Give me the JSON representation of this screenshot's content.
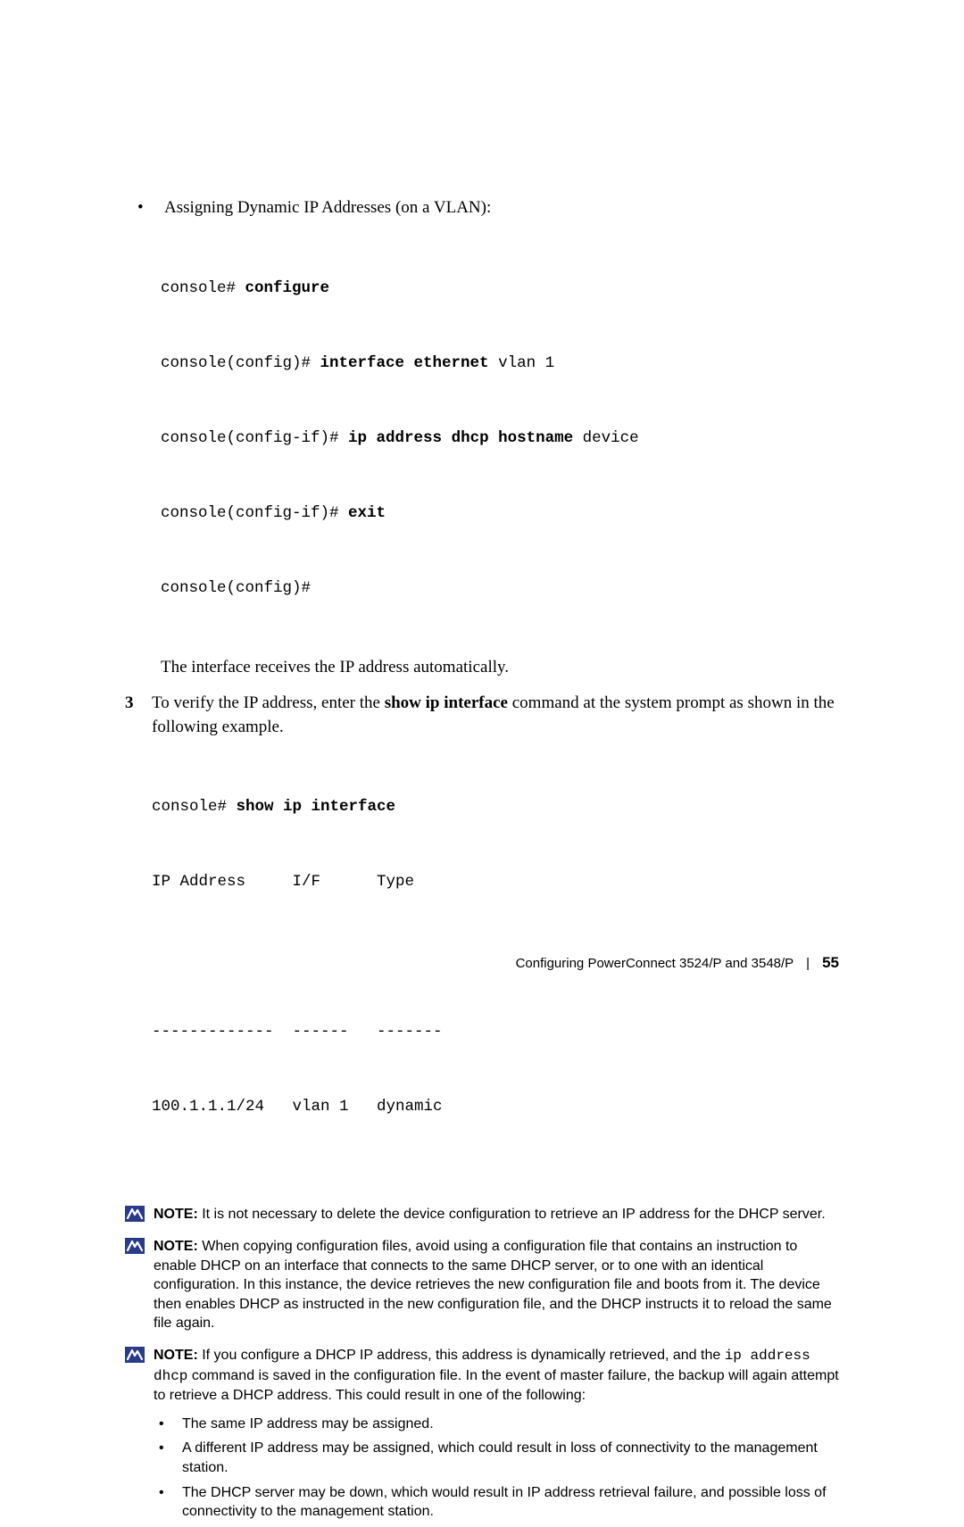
{
  "bullet1": "Assigning Dynamic IP Addresses (on a VLAN):",
  "code1": {
    "l1a": "console# ",
    "l1b": "configure",
    "l2a": "console(config)# ",
    "l2b": "interface ethernet",
    "l2c": " vlan 1",
    "l3a": "console(config-if)# ",
    "l3b": "ip address dhcp hostname",
    "l3c": " device",
    "l4a": "console(config-if)# ",
    "l4b": "exit",
    "l5": "console(config)# "
  },
  "after_code1": "The interface receives the IP address automatically.",
  "step3_num": "3",
  "step3_a": "To verify the IP address, enter the ",
  "step3_bold": "show ip interface",
  "step3_b": " command at the system prompt as shown in the following example.",
  "code2": {
    "l1a": "console# ",
    "l1b": "show ip interface",
    "l2": "IP Address     I/F      Type",
    "l3": " ",
    "l4": "-------------  ------   -------",
    "l5": "100.1.1.1/24   vlan 1   dynamic"
  },
  "note1_label": "NOTE: ",
  "note1_text": "It is not necessary to delete the device configuration to retrieve an IP address for the DHCP server.",
  "note2_label": "NOTE: ",
  "note2_text": "When copying configuration files, avoid using a configuration file that contains an instruction to enable DHCP on an interface that connects to the same DHCP server, or to one with an identical configuration. In this instance, the device retrieves the new configuration file and boots from it. The device then enables DHCP as instructed in the new configuration file, and the DHCP instructs it to reload the same file again.",
  "note3_label": "NOTE: ",
  "note3_a": "If you configure a DHCP IP address, this address is dynamically retrieved, and the ",
  "note3_mono": "ip address dhcp",
  "note3_b": " command is saved in the configuration file. In the event of master failure, the backup will again attempt to retrieve a DHCP address. This could result in one of the following:",
  "sub1": "The same IP address may be assigned.",
  "sub2": "A different IP address may be assigned, which could result in loss of connectivity to the management station.",
  "sub3": "The DHCP server may be down, which would result in IP address retrieval failure, and possible loss of connectivity to the management station.",
  "footer_text": "Configuring PowerConnect 3524/P and 3548/P",
  "footer_page": "55"
}
